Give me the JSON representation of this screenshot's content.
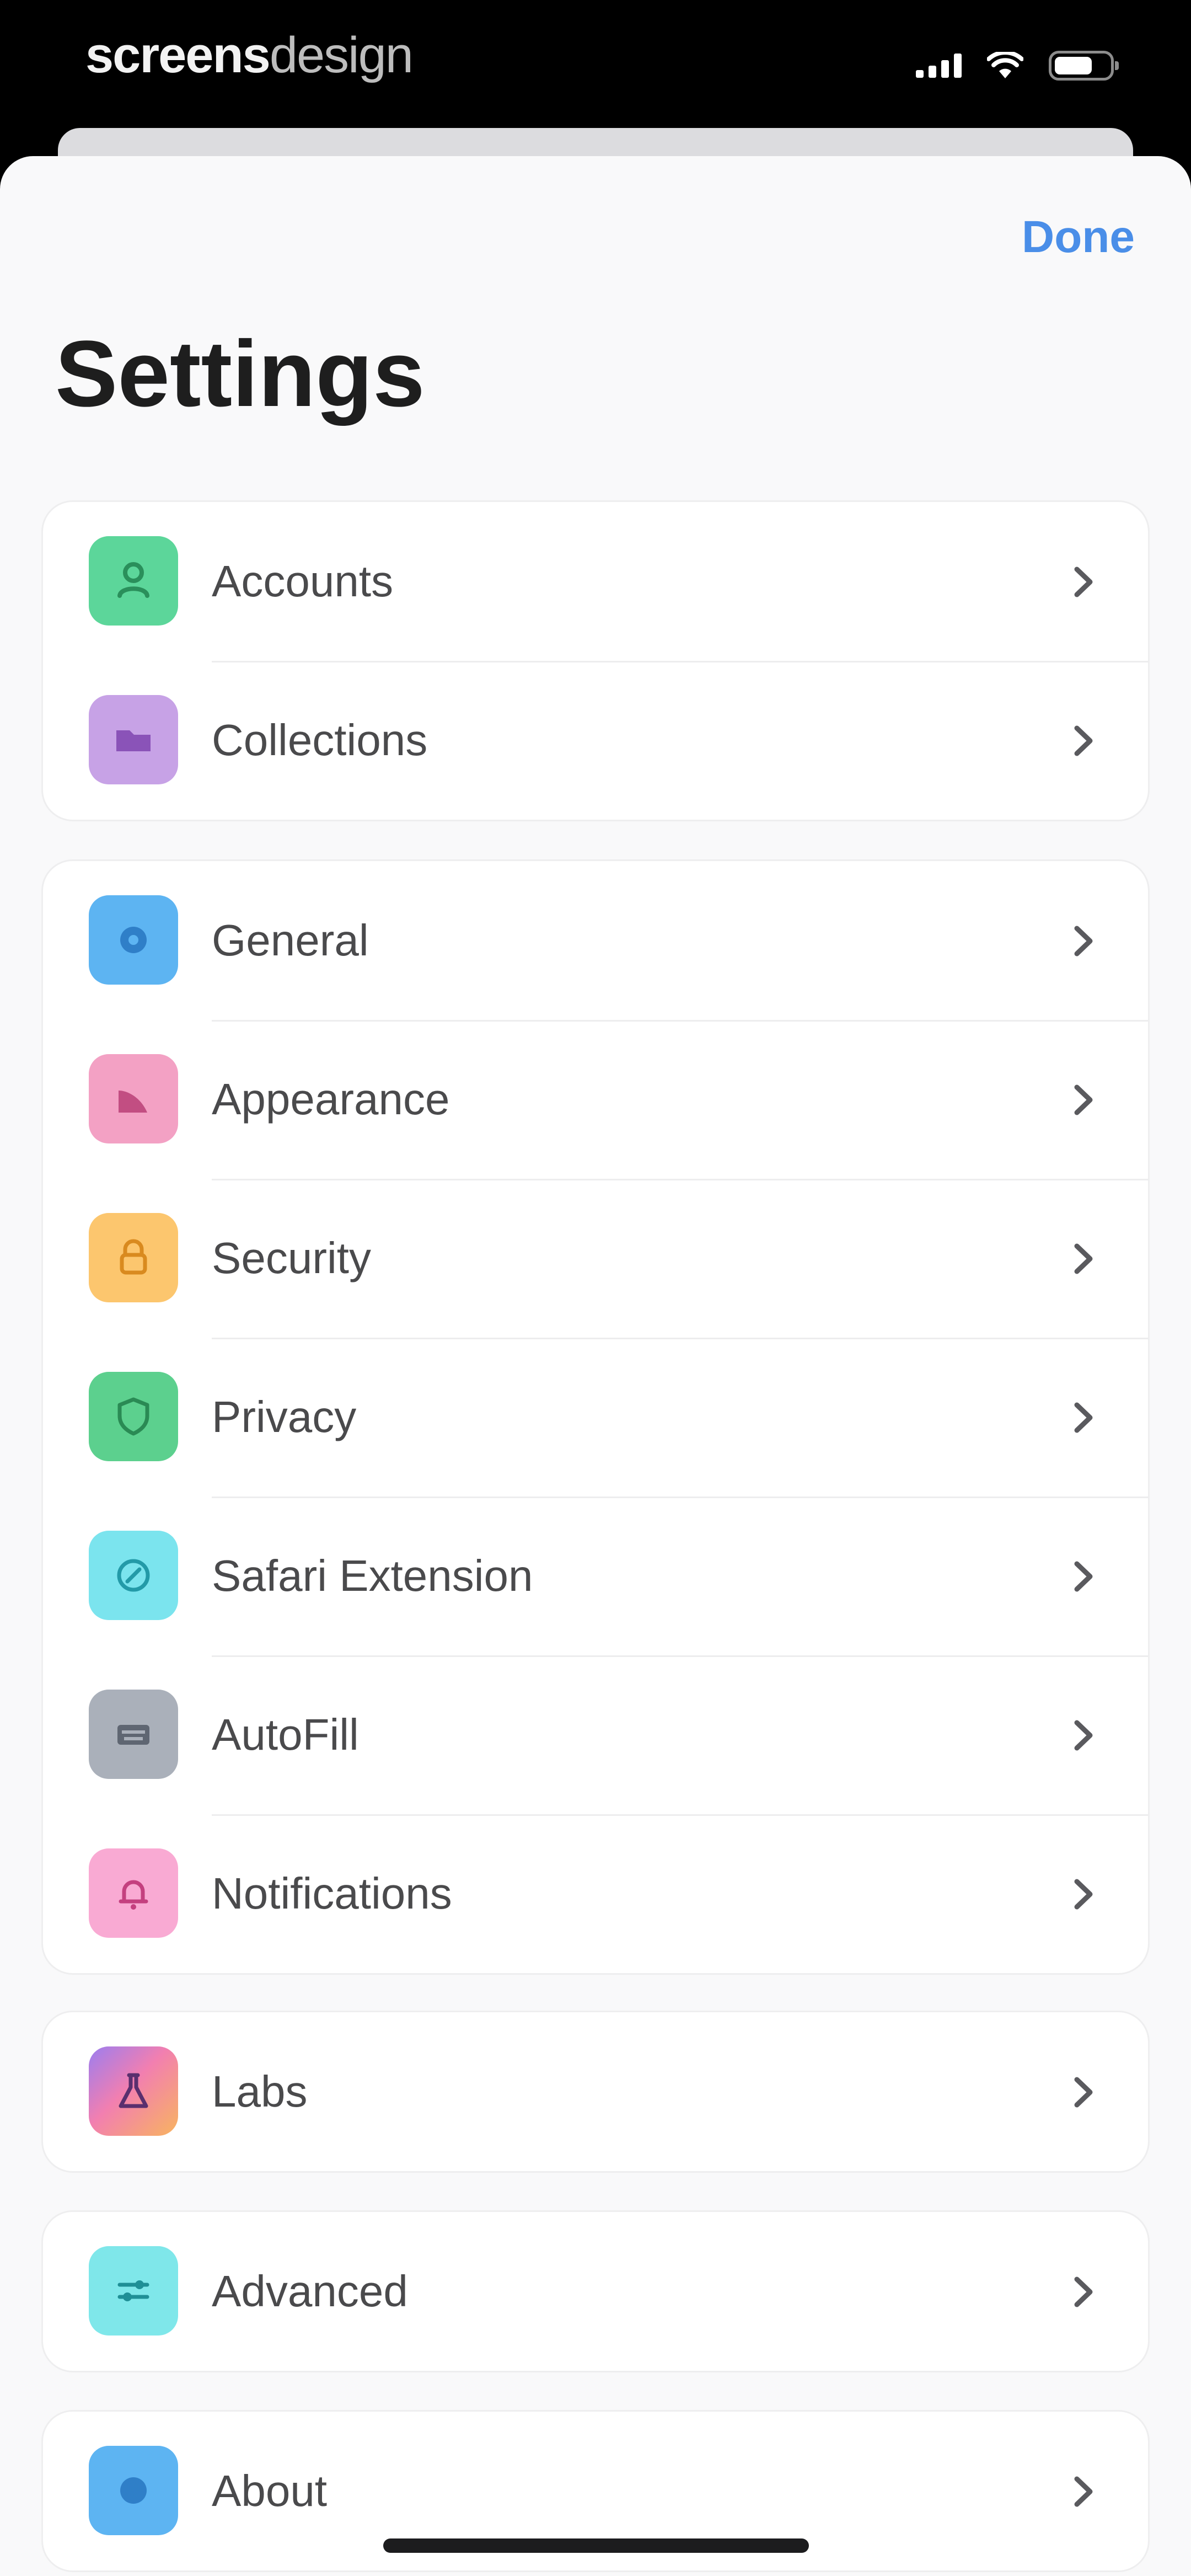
{
  "status_bar": {
    "brand_bold": "screens",
    "brand_light": "design"
  },
  "header": {
    "done_label": "Done",
    "title": "Settings"
  },
  "groups": [
    {
      "items": [
        {
          "label": "Accounts",
          "icon": "person-icon",
          "color": "#5cd69a"
        },
        {
          "label": "Collections",
          "icon": "folder-icon",
          "color": "#c7a2e6"
        }
      ]
    },
    {
      "items": [
        {
          "label": "General",
          "icon": "gear-icon",
          "color": "#5db4f2"
        },
        {
          "label": "Appearance",
          "icon": "brush-icon",
          "color": "#f3a1c4"
        },
        {
          "label": "Security",
          "icon": "lock-icon",
          "color": "#fcc66e"
        },
        {
          "label": "Privacy",
          "icon": "shield-icon",
          "color": "#5cd08e"
        },
        {
          "label": "Safari Extension",
          "icon": "compass-icon",
          "color": "#7be4ee"
        },
        {
          "label": "AutoFill",
          "icon": "keyboard-icon",
          "color": "#aab0ba"
        },
        {
          "label": "Notifications",
          "icon": "bell-icon",
          "color": "#f9aad3"
        }
      ]
    },
    {
      "items": [
        {
          "label": "Labs",
          "icon": "flask-icon",
          "color": "#c98ee9"
        }
      ]
    },
    {
      "items": [
        {
          "label": "Advanced",
          "icon": "sliders-icon",
          "color": "#7fe7ea"
        }
      ]
    },
    {
      "items": [
        {
          "label": "About",
          "icon": "info-icon",
          "color": "#5db4f2"
        }
      ]
    }
  ]
}
